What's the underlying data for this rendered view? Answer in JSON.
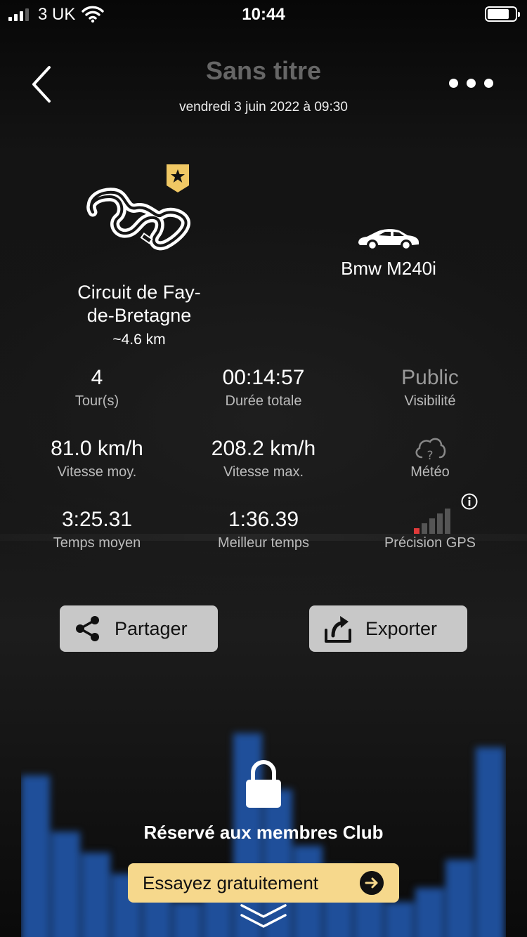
{
  "status_bar": {
    "carrier": "3 UK",
    "time": "10:44"
  },
  "header": {
    "title": "Sans titre",
    "date": "vendredi 3 juin 2022 à 09:30"
  },
  "circuit": {
    "name": "Circuit de Fay-de-Bretagne",
    "name_line1": "Circuit de Fay-",
    "name_line2": "de-Bretagne",
    "length": "~4.6 km"
  },
  "car": {
    "name": "Bmw M240i"
  },
  "stats": {
    "laps": {
      "value": "4",
      "label": "Tour(s)"
    },
    "total_time": {
      "value": "00:14:57",
      "label": "Durée totale"
    },
    "visibility": {
      "value": "Public",
      "label": "Visibilité"
    },
    "avg_speed": {
      "value": "81.0 km/h",
      "label": "Vitesse moy."
    },
    "max_speed": {
      "value": "208.2 km/h",
      "label": "Vitesse max."
    },
    "weather": {
      "label": "Météo"
    },
    "avg_time": {
      "value": "3:25.31",
      "label": "Temps moyen"
    },
    "best_time": {
      "value": "1:36.39",
      "label": "Meilleur temps"
    },
    "gps": {
      "label": "Précision GPS",
      "level_bars": 1,
      "total_bars": 5
    }
  },
  "actions": {
    "share_label": "Partager",
    "export_label": "Exporter"
  },
  "locked": {
    "message": "Réservé aux membres Club",
    "cta_label": "Essayez gratuitement"
  },
  "colors": {
    "accent_gold": "#f6d88c",
    "gps_active": "#e03a3a",
    "chart_blue": "#1f4f9a",
    "button_grey": "#c8c8c8"
  }
}
